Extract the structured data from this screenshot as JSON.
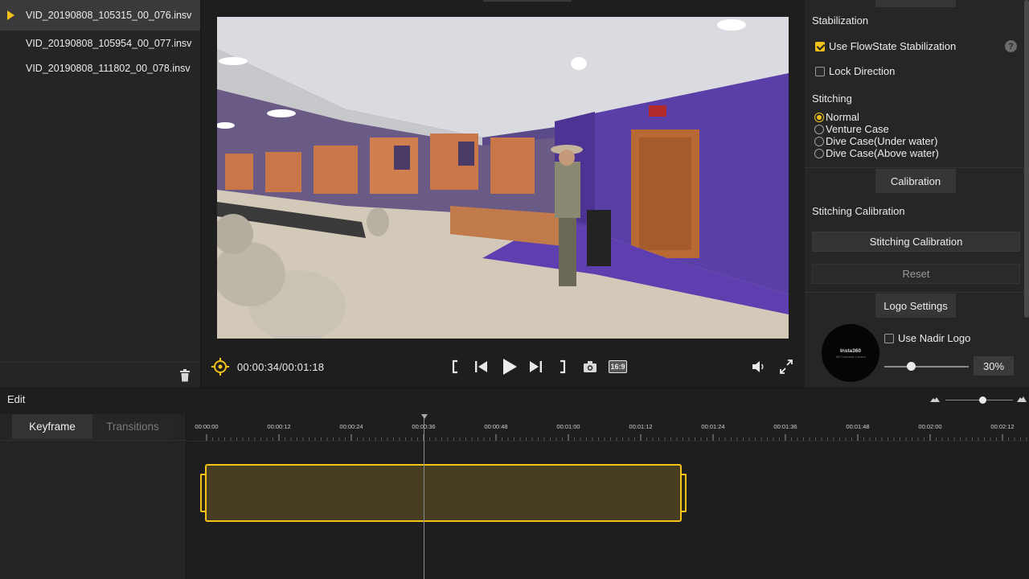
{
  "files": [
    {
      "name": "VID_20190808_105315_00_076.insv",
      "active": true
    },
    {
      "name": "VID_20190808_105954_00_077.insv",
      "active": false
    },
    {
      "name": "VID_20190808_111802_00_078.insv",
      "active": false
    }
  ],
  "player": {
    "timecode": "00:00:34/00:01:18",
    "aspect_ratio": "16:9",
    "icons": [
      "locate-icon",
      "mark-in-icon",
      "previous-icon",
      "play-icon",
      "next-icon",
      "mark-out-icon",
      "snapshot-icon",
      "volume-icon",
      "fullscreen-icon"
    ]
  },
  "right_panel": {
    "stabilization": {
      "heading": "Stabilization",
      "flowstate_label": "Use FlowState Stabilization",
      "flowstate_checked": true,
      "lock_direction_label": "Lock Direction",
      "lock_direction_checked": false,
      "help": "?"
    },
    "stitching": {
      "heading": "Stitching",
      "options": [
        "Normal",
        "Venture Case",
        "Dive Case(Under water)",
        "Dive Case(Above water)"
      ],
      "selected": "Normal"
    },
    "calibration": {
      "section_label": "Calibration",
      "heading": "Stitching Calibration",
      "calibrate_button": "Stitching Calibration",
      "reset_button": "Reset"
    },
    "logo": {
      "section_label": "Logo Settings",
      "nadir_label": "Use Nadir Logo",
      "nadir_checked": false,
      "logo_text": "Insta360",
      "logo_subtext": "360 Panoramic Camera",
      "size_percent": "30%",
      "size_value": 0.3
    }
  },
  "edit": {
    "label": "Edit",
    "tabs": {
      "keyframe": "Keyframe",
      "transitions": "Transitions"
    },
    "ruler_labels": [
      "00:00:00",
      "00:00:12",
      "00:00:24",
      "00:00:36",
      "00:00:48",
      "00:01:00",
      "00:01:12",
      "00:01:24",
      "00:01:36",
      "00:01:48",
      "00:02:00",
      "00:02:12"
    ],
    "playhead_time": "00:00:34",
    "clip_duration": "00:01:18"
  },
  "colors": {
    "accent": "#f2c21a",
    "panel": "#262626",
    "background": "#1c1c1c",
    "clip_fill": "#473e21"
  }
}
